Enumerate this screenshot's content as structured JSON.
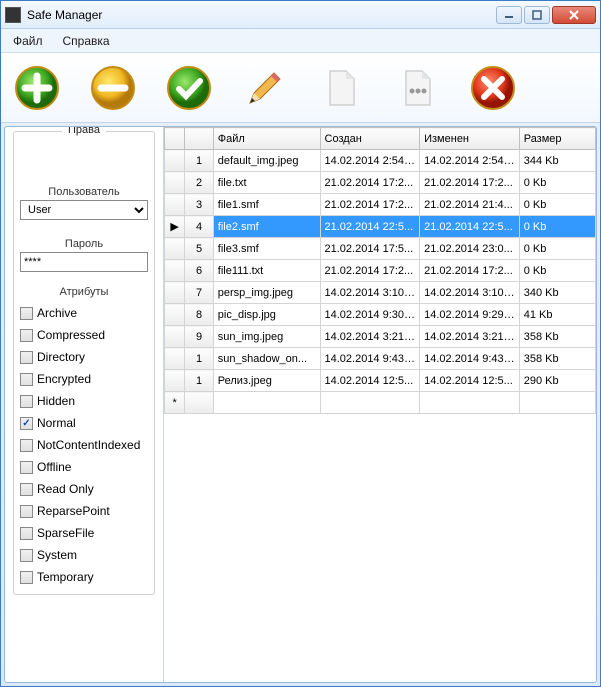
{
  "window": {
    "title": "Safe Manager"
  },
  "menu": {
    "file": "Файл",
    "help": "Справка"
  },
  "toolbar": {
    "add": "add",
    "remove": "remove",
    "apply": "apply",
    "edit": "edit",
    "new": "new",
    "props": "props",
    "cancel": "cancel"
  },
  "left": {
    "rights_title": "Права",
    "user_label": "Пользователь",
    "user_value": "User",
    "pass_label": "Пароль",
    "pass_value": "****",
    "attrs_title": "Атрибуты",
    "attrs": [
      {
        "label": "Archive",
        "checked": false
      },
      {
        "label": "Compressed",
        "checked": false
      },
      {
        "label": "Directory",
        "checked": false
      },
      {
        "label": "Encrypted",
        "checked": false
      },
      {
        "label": "Hidden",
        "checked": false
      },
      {
        "label": "Normal",
        "checked": true
      },
      {
        "label": "NotContentIndexed",
        "checked": false
      },
      {
        "label": "Offline",
        "checked": false
      },
      {
        "label": "Read Only",
        "checked": false
      },
      {
        "label": "ReparsePoint",
        "checked": false
      },
      {
        "label": "SparseFile",
        "checked": false
      },
      {
        "label": "System",
        "checked": false
      },
      {
        "label": "Temporary",
        "checked": false
      }
    ]
  },
  "grid": {
    "cols": {
      "file": "Файл",
      "created": "Создан",
      "modified": "Изменен",
      "size": "Размер"
    },
    "selected_index": 3,
    "rows": [
      {
        "n": "1",
        "file": "default_img.jpeg",
        "created": "14.02.2014 2:54:...",
        "modified": "14.02.2014 2:54:...",
        "size": "344 Kb",
        "mark": ""
      },
      {
        "n": "2",
        "file": "file.txt",
        "created": "21.02.2014 17:2...",
        "modified": "21.02.2014 17:2...",
        "size": "0 Kb",
        "mark": ""
      },
      {
        "n": "3",
        "file": "file1.smf",
        "created": "21.02.2014 17:2...",
        "modified": "21.02.2014 21:4...",
        "size": "0 Kb",
        "mark": ""
      },
      {
        "n": "4",
        "file": "file2.smf",
        "created": "21.02.2014 22:5...",
        "modified": "21.02.2014 22:5...",
        "size": "0 Kb",
        "mark": "▶"
      },
      {
        "n": "5",
        "file": "file3.smf",
        "created": "21.02.2014 17:5...",
        "modified": "21.02.2014 23:0...",
        "size": "0 Kb",
        "mark": ""
      },
      {
        "n": "6",
        "file": "file111.txt",
        "created": "21.02.2014 17:2...",
        "modified": "21.02.2014 17:2...",
        "size": "0 Kb",
        "mark": ""
      },
      {
        "n": "7",
        "file": "persp_img.jpeg",
        "created": "14.02.2014 3:10:...",
        "modified": "14.02.2014 3:10:...",
        "size": "340 Kb",
        "mark": ""
      },
      {
        "n": "8",
        "file": "pic_disp.jpg",
        "created": "14.02.2014 9:30:...",
        "modified": "14.02.2014 9:29:...",
        "size": "41 Kb",
        "mark": ""
      },
      {
        "n": "9",
        "file": "sun_img.jpeg",
        "created": "14.02.2014 3:21:...",
        "modified": "14.02.2014 3:21:...",
        "size": "358 Kb",
        "mark": ""
      },
      {
        "n": "1",
        "file": "sun_shadow_on...",
        "created": "14.02.2014 9:43:...",
        "modified": "14.02.2014 9:43:...",
        "size": "358 Kb",
        "mark": ""
      },
      {
        "n": "1",
        "file": "Релиз.jpeg",
        "created": "14.02.2014 12:5...",
        "modified": "14.02.2014 12:5...",
        "size": "290 Kb",
        "mark": ""
      },
      {
        "n": "",
        "file": "",
        "created": "",
        "modified": "",
        "size": "",
        "mark": "*"
      }
    ]
  }
}
